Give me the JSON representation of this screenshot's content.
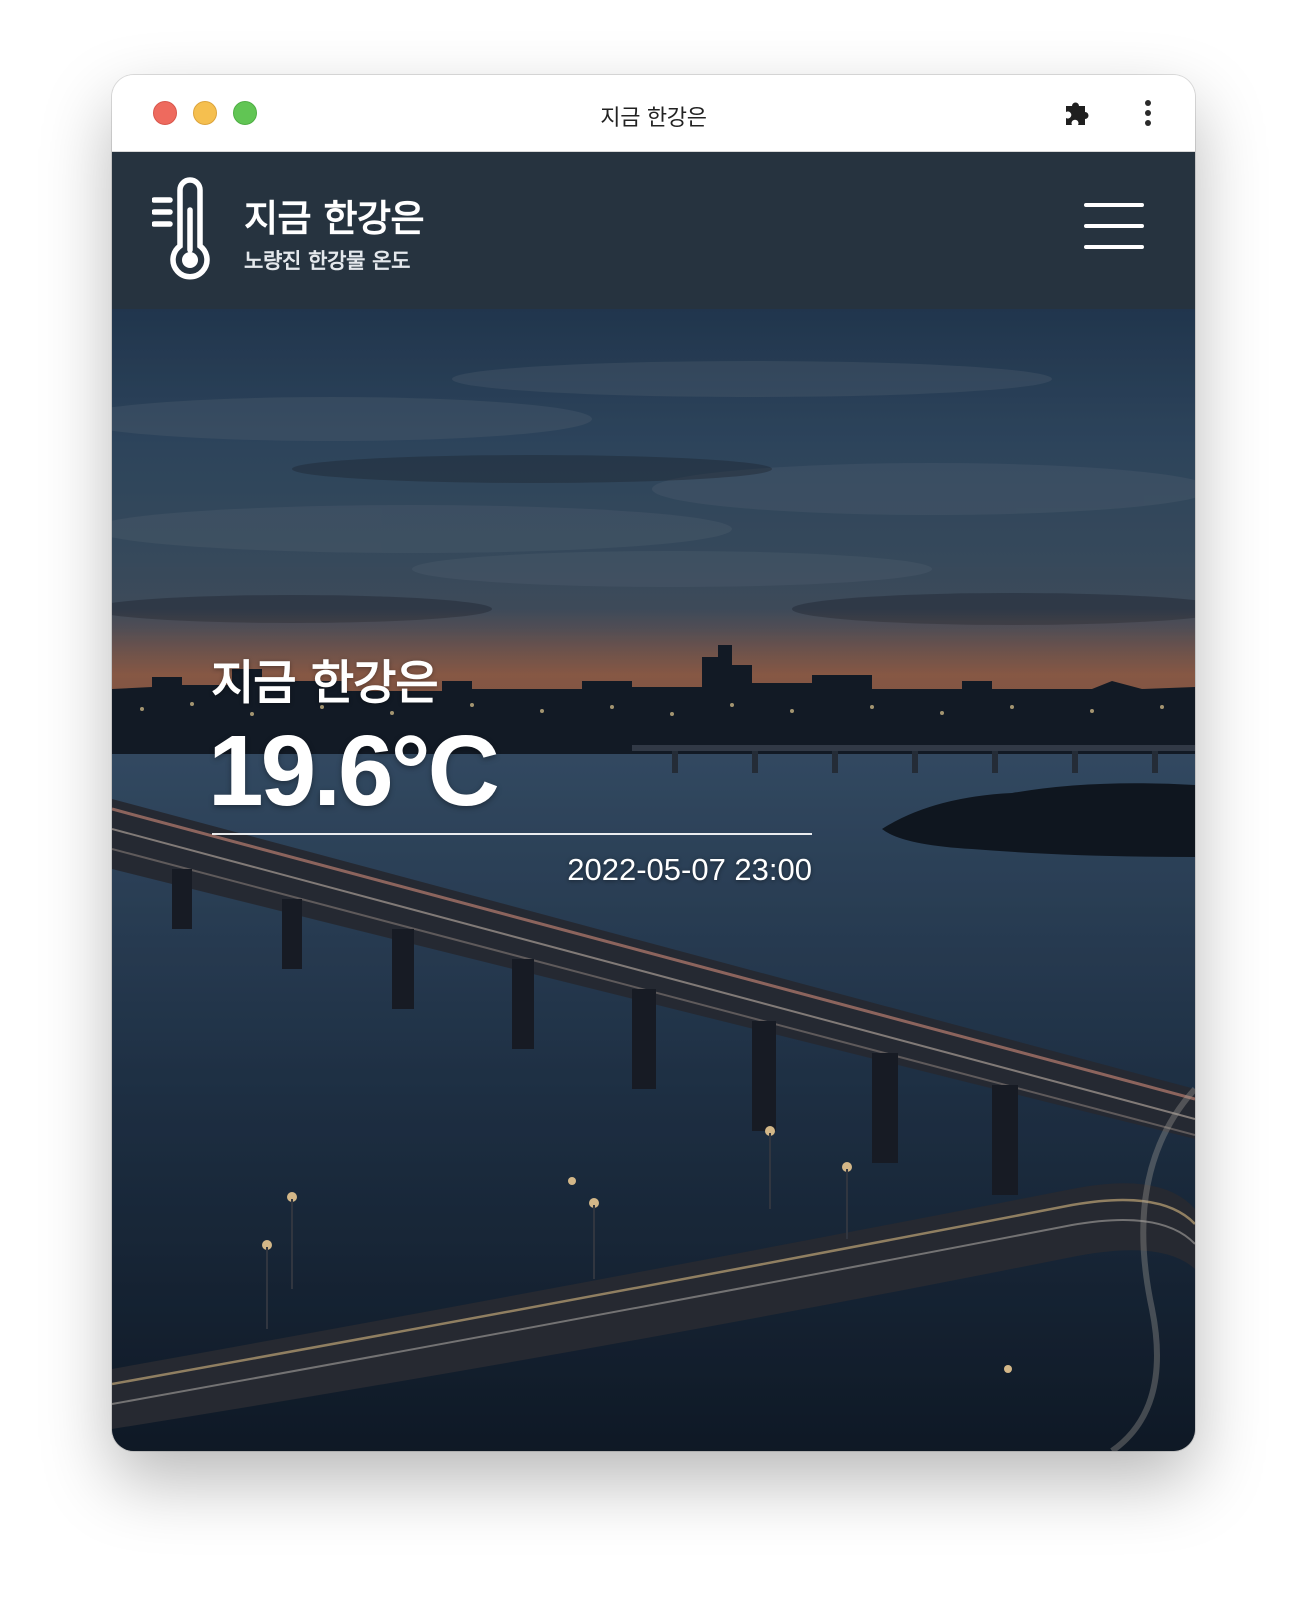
{
  "window": {
    "title": "지금 한강은"
  },
  "toolbar": {
    "extensions_icon": "puzzle-icon",
    "menu_icon": "kebab-menu-icon"
  },
  "header": {
    "logo_icon": "thermometer-icon",
    "title": "지금 한강은",
    "subtitle": "노량진 한강물 온도",
    "menu_icon": "hamburger-icon",
    "background_color": "#26333f"
  },
  "hero": {
    "title": "지금 한강은",
    "temperature": "19.6°C",
    "measured_at": "2022-05-07 23:00",
    "background": "night-skyline-bridge-photo"
  }
}
